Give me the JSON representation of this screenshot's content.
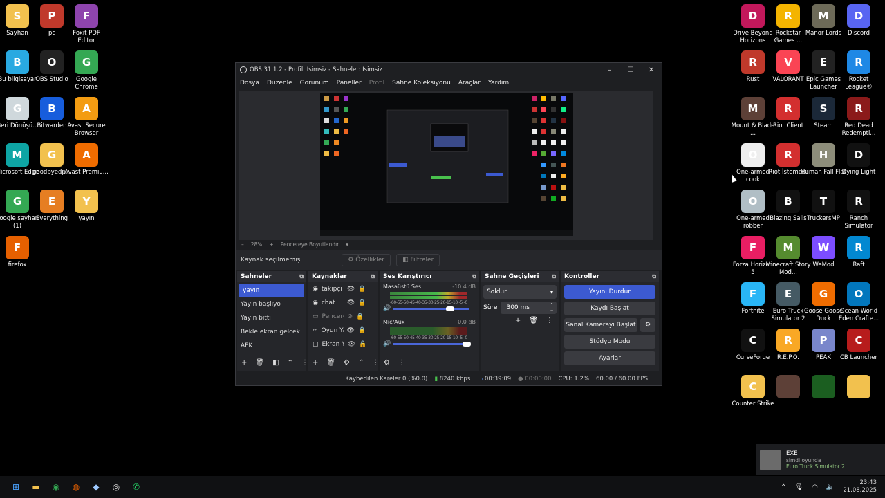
{
  "desktop_left": [
    {
      "label": "Sayhan",
      "icon": "folder-icon",
      "color": "#f2c14e"
    },
    {
      "label": "pc",
      "icon": "app-icon",
      "color": "#c0392b"
    },
    {
      "label": "Foxit PDF Editor",
      "icon": "pdf-icon",
      "color": "#8e44ad"
    },
    {
      "label": "Bu bilgisayar",
      "icon": "computer-icon",
      "color": "#29a9e1"
    },
    {
      "label": "OBS Studio",
      "icon": "obs-icon",
      "color": "#222"
    },
    {
      "label": "Google Chrome",
      "icon": "chrome-icon",
      "color": "#34a853"
    },
    {
      "label": "Geri Dönüşü...",
      "icon": "recycle-bin-icon",
      "color": "#cfd8dc"
    },
    {
      "label": "Bitwarden",
      "icon": "shield-icon",
      "color": "#175ddc"
    },
    {
      "label": "Avast Secure Browser",
      "icon": "browser-icon",
      "color": "#f39c12"
    },
    {
      "label": "Microsoft Edge",
      "icon": "edge-icon",
      "color": "#0ea5a4"
    },
    {
      "label": "goodbyedp...",
      "icon": "folder-icon",
      "color": "#f2c14e"
    },
    {
      "label": "Avast Premiu...",
      "icon": "avast-icon",
      "color": "#ef6c00"
    },
    {
      "label": "google sayhan (1)",
      "icon": "chrome-icon",
      "color": "#34a853"
    },
    {
      "label": "Everything",
      "icon": "search-icon",
      "color": "#e67e22"
    },
    {
      "label": "yayın",
      "icon": "folder-icon",
      "color": "#f2c14e"
    },
    {
      "label": "firefox",
      "icon": "firefox-icon",
      "color": "#e66000"
    }
  ],
  "desktop_right": [
    {
      "label": "Drive Beyond Horizons",
      "icon": "game-icon",
      "color": "#c2185b"
    },
    {
      "label": "Rockstar Games ...",
      "icon": "rockstar-icon",
      "color": "#f4b400"
    },
    {
      "label": "Manor Lords",
      "icon": "game-icon",
      "color": "#6d6a58"
    },
    {
      "label": "Discord",
      "icon": "discord-icon",
      "color": "#5865f2"
    },
    {
      "label": "Rust",
      "icon": "rust-icon",
      "color": "#c0392b"
    },
    {
      "label": "VALORANT",
      "icon": "valorant-icon",
      "color": "#fa4454"
    },
    {
      "label": "Epic Games Launcher",
      "icon": "epic-icon",
      "color": "#222"
    },
    {
      "label": "Rocket League®",
      "icon": "game-icon",
      "color": "#1e88e5"
    },
    {
      "label": "Mount & Blade ...",
      "icon": "game-icon",
      "color": "#5d4037"
    },
    {
      "label": "Riot Client",
      "icon": "riot-icon",
      "color": "#d32f2f"
    },
    {
      "label": "Steam",
      "icon": "steam-icon",
      "color": "#1b2838"
    },
    {
      "label": "Red Dead Redempti...",
      "icon": "game-icon",
      "color": "#8b1a1a"
    },
    {
      "label": "One-armed cook",
      "icon": "game-icon",
      "color": "#eeeeee"
    },
    {
      "label": "Riot İstemcisi",
      "icon": "riot-icon",
      "color": "#d32f2f"
    },
    {
      "label": "Human Fall Flat",
      "icon": "game-icon",
      "color": "#8d8d7a"
    },
    {
      "label": "Dying Light",
      "icon": "game-icon",
      "color": "#111"
    },
    {
      "label": "One-armed robber",
      "icon": "game-icon",
      "color": "#b0bec5"
    },
    {
      "label": "Blazing Sails",
      "icon": "skull-icon",
      "color": "#111"
    },
    {
      "label": "TruckersMP",
      "icon": "game-icon",
      "color": "#111"
    },
    {
      "label": "Ranch Simulator",
      "icon": "game-icon",
      "color": "#111"
    },
    {
      "label": "Forza Horizon 5",
      "icon": "game-icon",
      "color": "#e91e63"
    },
    {
      "label": "Minecraft Story Mod...",
      "icon": "game-icon",
      "color": "#558b2f"
    },
    {
      "label": "WeMod",
      "icon": "wemod-icon",
      "color": "#7c4dff"
    },
    {
      "label": "Raft",
      "icon": "game-icon",
      "color": "#0288d1"
    },
    {
      "label": "Fortnite",
      "icon": "game-icon",
      "color": "#29b6f6"
    },
    {
      "label": "Euro Truck Simulator 2",
      "icon": "truck-icon",
      "color": "#455a64"
    },
    {
      "label": "Goose Goose Duck",
      "icon": "game-icon",
      "color": "#ef6c00"
    },
    {
      "label": "Ocean World Eden Crafte...",
      "icon": "game-icon",
      "color": "#0277bd"
    },
    {
      "label": "CurseForge",
      "icon": "curseforge-icon",
      "color": "#111"
    },
    {
      "label": "R.E.P.O.",
      "icon": "game-icon",
      "color": "#f9a825"
    },
    {
      "label": "PEAK",
      "icon": "game-icon",
      "color": "#7986cb"
    },
    {
      "label": "CB Launcher",
      "icon": "game-icon",
      "color": "#b71c1c"
    },
    {
      "label": "Counter Strike",
      "icon": "folder-icon",
      "color": "#f2c14e"
    },
    {
      "label": "",
      "icon": "game-icon",
      "color": "#5d4037"
    },
    {
      "label": "",
      "icon": "gta-icon",
      "color": "#1b5e20"
    },
    {
      "label": "",
      "icon": "folder-icon",
      "color": "#f2c14e"
    }
  ],
  "obs": {
    "title": "OBS 31.1.2 - Profil: İsimsiz - Sahneler: İsimsiz",
    "menu": [
      "Dosya",
      "Düzenle",
      "Görünüm",
      "Paneller",
      "Profil",
      "Sahne Koleksiyonu",
      "Araçlar",
      "Yardım"
    ],
    "zoom": "28%",
    "fit_label": "Pencereye Boyutlandır",
    "no_source": "Kaynak seçilmemiş",
    "properties": "Özellikler",
    "filters": "Filtreler",
    "scenes_title": "Sahneler",
    "scenes": [
      "yayın",
      "Yayın başlıyo",
      "Yayın bitti",
      "Bekle ekran gelcek",
      "AFK"
    ],
    "sources_title": "Kaynaklar",
    "sources": [
      {
        "name": "takipçi",
        "icon": "browser-source-icon",
        "hidden": false
      },
      {
        "name": "chat",
        "icon": "browser-source-icon",
        "hidden": false
      },
      {
        "name": "Pencere",
        "icon": "window-capture-icon",
        "hidden": true
      },
      {
        "name": "Oyun Ya",
        "icon": "game-capture-icon",
        "hidden": false
      },
      {
        "name": "Ekran Ya",
        "icon": "display-capture-icon",
        "hidden": false
      }
    ],
    "mixer_title": "Ses Karıştırıcı",
    "mixer": [
      {
        "name": "Masaüstü Ses",
        "db": "-10.4 dB",
        "level": 0.75,
        "volume": 0.6
      },
      {
        "name": "Mic/Aux",
        "db": "0.0 dB",
        "level": 0.45,
        "volume": 0.93
      }
    ],
    "meter_ticks": "-60-55-50-45-40-35-30-25-20-15-10 -5 -0",
    "transitions_title": "Sahne Geçişleri",
    "transition": "Soldur",
    "duration_label": "Süre",
    "duration": "300 ms",
    "controls_title": "Kontroller",
    "controls": [
      "Yayını Durdur",
      "Kaydı Başlat",
      "Sanal Kamerayı Başlat",
      "Stüdyo Modu",
      "Ayarlar"
    ],
    "status": {
      "dropped": "Kaybedilen Kareler 0 (%0.0)",
      "bitrate": "8240 kbps",
      "stream_time": "00:39:09",
      "rec_time": "00:00:00",
      "cpu": "CPU: 1.2%",
      "fps": "60.00 / 60.00 FPS"
    }
  },
  "notification": {
    "title": "EXE",
    "subtitle": "şimdi oyunda",
    "game": "Euro Truck Simulator 2"
  },
  "taskbar": {
    "time": "23:43",
    "date": "21.08.2025"
  }
}
